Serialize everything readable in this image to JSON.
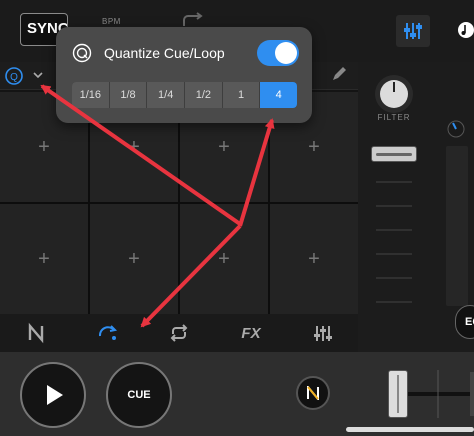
{
  "topbar": {
    "sync_label": "SYNC",
    "bpm_label": "BPM"
  },
  "right_panel": {
    "filter_label": "FILTER",
    "eq_label": "EQ"
  },
  "popover": {
    "title": "Quantize Cue/Loop",
    "toggle_on": true,
    "options": [
      "1/16",
      "1/8",
      "1/4",
      "1/2",
      "1",
      "4"
    ],
    "selected": "4"
  },
  "pads": {
    "plus_symbol": "+"
  },
  "bottom": {
    "cue_label": "CUE"
  },
  "colors": {
    "accent": "#2f8ef0",
    "arrow": "#e8343f"
  }
}
